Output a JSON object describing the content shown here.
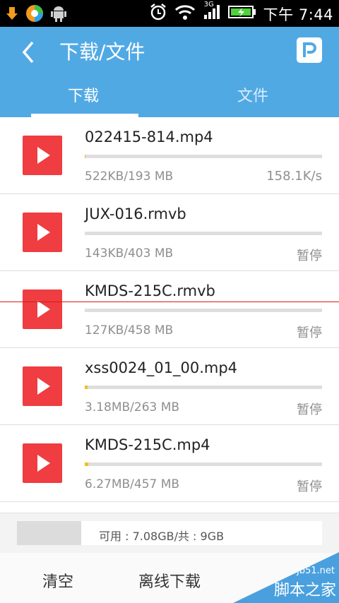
{
  "status_bar": {
    "time": "下午 7:44",
    "network": "3G",
    "icons": [
      "download-icon",
      "store-app-icon",
      "android-icon",
      "alarm-icon",
      "wifi-icon",
      "signal-icon",
      "battery-charging-icon"
    ]
  },
  "app_bar": {
    "title": "下载/文件",
    "tabs": [
      {
        "label": "下载",
        "active": true
      },
      {
        "label": "文件",
        "active": false
      }
    ]
  },
  "downloads": [
    {
      "name": "022415-814.mp4",
      "size": "522KB/193 MB",
      "status": "158.1K/s",
      "progress": 0.003
    },
    {
      "name": "JUX-016.rmvb",
      "size": "143KB/403 MB",
      "status": "暂停",
      "progress": 0.0003
    },
    {
      "name": "KMDS-215C.rmvb",
      "size": "127KB/458 MB",
      "status": "暂停",
      "progress": 0.0003
    },
    {
      "name": "xss0024_01_00.mp4",
      "size": "3.18MB/263 MB",
      "status": "暂停",
      "progress": 0.012
    },
    {
      "name": "KMDS-215C.mp4",
      "size": "6.27MB/457 MB",
      "status": "暂停",
      "progress": 0.014
    }
  ],
  "storage": {
    "text": "可用 : 7.08GB/共 : 9GB",
    "used_fraction": 0.21
  },
  "bottom_bar": {
    "clear_label": "清空",
    "offline_label": "离线下载"
  },
  "watermark": {
    "site": "jb51.net",
    "text": "脚本之家"
  },
  "colors": {
    "accent": "#51a9e4",
    "play": "#ef3d41",
    "progress": "#f2c01c",
    "status_bar": "#000000"
  }
}
